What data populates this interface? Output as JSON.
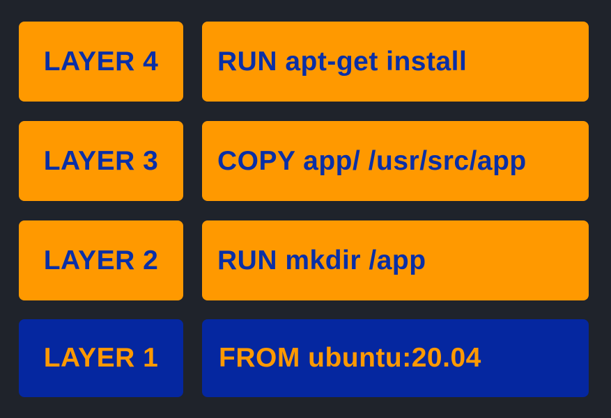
{
  "layers": [
    {
      "label": "LAYER 4",
      "command": "RUN apt-get install"
    },
    {
      "label": "LAYER 3",
      "command": "COPY app/ /usr/src/app"
    },
    {
      "label": "LAYER 2",
      "command": "RUN mkdir /app"
    },
    {
      "label": "LAYER 1",
      "command": "FROM ubuntu:20.04"
    }
  ],
  "colors": {
    "background": "#1f232b",
    "orange": "#ff9900",
    "blue": "#0527a0",
    "text_on_orange": "#0a2fa6",
    "text_on_blue": "#ff9900"
  }
}
